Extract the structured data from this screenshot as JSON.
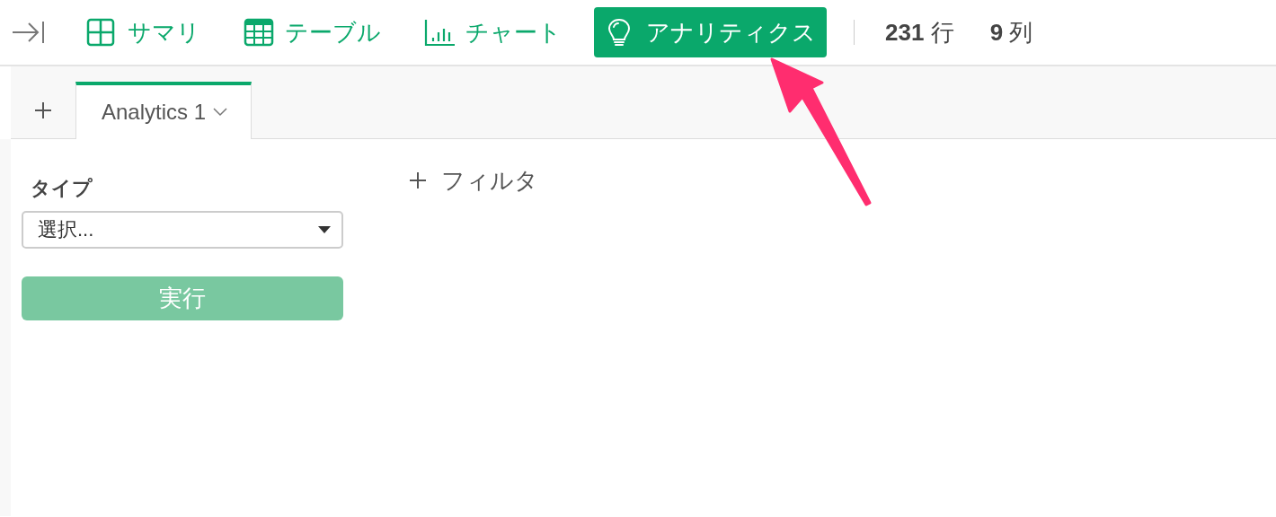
{
  "toolbar": {
    "views": [
      {
        "kind": "summary",
        "label": "サマリ",
        "selected": false
      },
      {
        "kind": "table",
        "label": "テーブル",
        "selected": false
      },
      {
        "kind": "chart",
        "label": "チャート",
        "selected": false
      },
      {
        "kind": "analytics",
        "label": "アナリティクス",
        "selected": true
      }
    ],
    "rows_count": "**231** 行",
    "columns_count": "**9** 列"
  },
  "tabs": [
    {
      "label": "Analytics 1",
      "selected": true
    }
  ],
  "panel": {
    "type_label": "タイプ",
    "type_select": {
      "value": "選択..."
    },
    "run_button": {
      "label": "実行",
      "disabled": true
    }
  },
  "filter": {
    "label": "フィルタ"
  }
}
